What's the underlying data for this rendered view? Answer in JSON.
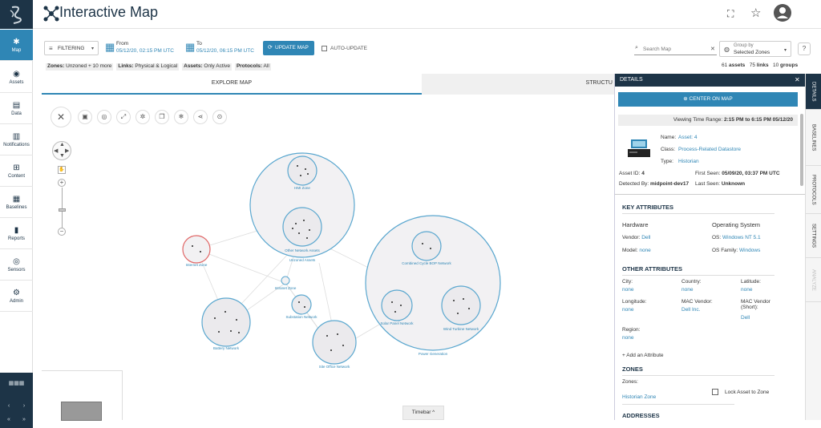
{
  "app": {
    "title": "Interactive Map"
  },
  "nav": {
    "items": [
      {
        "label": "Map",
        "icon": "map-icon"
      },
      {
        "label": "Assets",
        "icon": "assets-icon"
      },
      {
        "label": "Data",
        "icon": "data-icon"
      },
      {
        "label": "Notifications",
        "icon": "notifications-icon"
      },
      {
        "label": "Content",
        "icon": "content-icon"
      },
      {
        "label": "Baselines",
        "icon": "baselines-icon"
      },
      {
        "label": "Reports",
        "icon": "reports-icon"
      },
      {
        "label": "Sensors",
        "icon": "sensors-icon"
      },
      {
        "label": "Admin",
        "icon": "admin-icon"
      }
    ]
  },
  "toolbar": {
    "filtering": "FILTERING",
    "from_label": "From",
    "from_value": "05/12/20, 02:15 PM UTC",
    "to_label": "To",
    "to_value": "05/12/20, 06:15 PM UTC",
    "update": "UPDATE MAP",
    "auto_update": "AUTO-UPDATE",
    "search_placeholder": "Search Map",
    "group_by_label": "Group by",
    "group_by_value": "Selected Zones",
    "filters": {
      "zones_k": "Zones:",
      "zones_v": "Unzoned + 10 more",
      "links_k": "Links:",
      "links_v": "Physical & Logical",
      "assets_k": "Assets:",
      "assets_v": "Only Active",
      "protocols_k": "Protocols:",
      "protocols_v": "All"
    },
    "counts": {
      "assets": "61",
      "assets_l": "assets",
      "links": "75",
      "links_l": "links",
      "groups": "10",
      "groups_l": "groups"
    }
  },
  "tabs": {
    "explore": "EXPLORE MAP",
    "structure": "STRUCTU"
  },
  "map": {
    "zones": {
      "hmi": "HMI Zone",
      "other": "Other Network Assets",
      "unzoned": "Unzoned Assets",
      "internet": "Internet Zone",
      "intranet": "Intranet Zone",
      "battery": "Battery Network",
      "substation": "Substation Network",
      "site": "Site Office Network",
      "power": "Power Generation",
      "combined": "Combined Cycle BOP Network",
      "solar": "Solar Panel Network",
      "wind": "Wind Turbine Network"
    },
    "timebar": "Timebar ^"
  },
  "details": {
    "title": "DETAILS",
    "center": "CENTER ON MAP",
    "range_label": "Viewing Time Range:",
    "range_value": "2:15 PM to 6:15 PM 05/12/20",
    "name_k": "Name:",
    "name_v": "Asset: 4",
    "class_k": "Class:",
    "class_v": "Process-Related Datastore",
    "type_k": "Type:",
    "type_v": "Historian",
    "assetid_k": "Asset ID:",
    "assetid_v": "4",
    "detected_k": "Detected By:",
    "detected_v": "midpoint-dev17",
    "firstseen_k": "First Seen:",
    "firstseen_v": "05/09/20, 03:37 PM UTC",
    "lastseen_k": "Last Seen:",
    "lastseen_v": "Unknown",
    "key_attrs": "KEY ATTRIBUTES",
    "hardware": "Hardware",
    "os": "Operating System",
    "vendor_k": "Vendor:",
    "vendor_v": "Dell",
    "model_k": "Model:",
    "model_v": "none",
    "osk": "OS:",
    "osv": "Windows NT 5.1",
    "osfam_k": "OS Family:",
    "osfam_v": "Windows",
    "other_attrs": "OTHER ATTRIBUTES",
    "city_k": "City:",
    "city_v": "none",
    "country_k": "Country:",
    "country_v": "none",
    "lat_k": "Latitude:",
    "lat_v": "none",
    "long_k": "Longitude:",
    "long_v": "none",
    "mac_k": "MAC Vendor:",
    "mac_v": "Dell Inc.",
    "macs_k": "MAC Vendor (Short):",
    "macs_v": "Dell",
    "region_k": "Region:",
    "region_v": "none",
    "add_attr": "+ Add an Attribute",
    "zones_h": "ZONES",
    "zones_k": "Zones:",
    "zones_v": "Historian Zone",
    "lock": "Lock Asset to Zone",
    "addresses": "ADDRESSES"
  },
  "sidetabs": [
    "DETAILS",
    "BASELINES",
    "PROTOCOLS",
    "SETTINGS",
    "ANALYZE"
  ]
}
